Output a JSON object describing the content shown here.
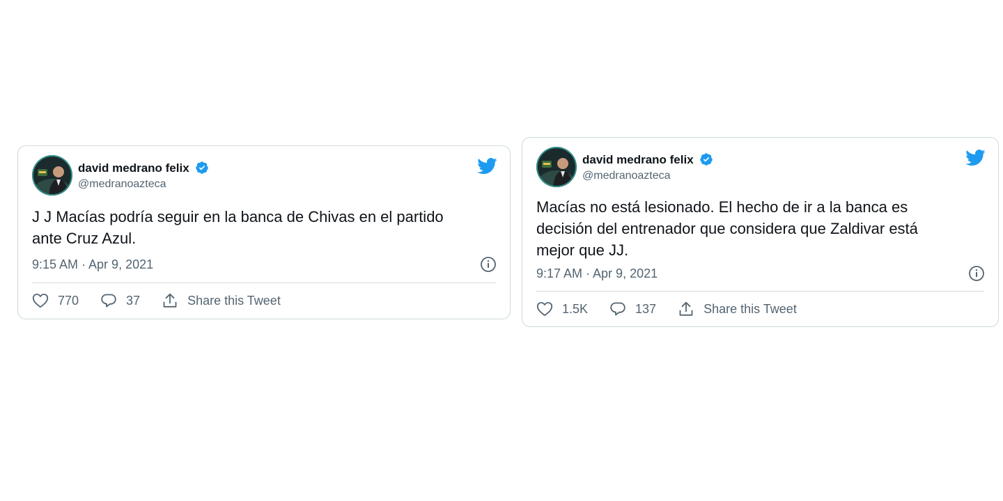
{
  "tweets": [
    {
      "author": {
        "name": "david medrano felix",
        "handle": "@medranoazteca"
      },
      "text": "J J Macías podría seguir en la banca de Chivas en el partido\nante Cruz Azul.",
      "timestamp": "9:15 AM · Apr 9, 2021",
      "likes": "770",
      "replies": "37",
      "share_label": "Share this Tweet"
    },
    {
      "author": {
        "name": "david medrano felix",
        "handle": "@medranoazteca"
      },
      "text": "Macías no está lesionado. El hecho de ir a la banca es\ndecisión del entrenador que considera que Zaldivar está\nmejor que JJ.",
      "timestamp": "9:17 AM · Apr 9, 2021",
      "likes": "1.5K",
      "replies": "137",
      "share_label": "Share this Tweet"
    }
  ],
  "icons": {
    "brand": "twitter-bird-icon",
    "verified": "verified-badge-icon",
    "info": "info-icon",
    "like": "heart-icon",
    "reply": "reply-icon",
    "share": "share-icon"
  },
  "colors": {
    "brand_blue": "#1d9bf0",
    "text_primary": "#0f1419",
    "text_secondary": "#536471",
    "border": "#cfd9de",
    "background": "#ffffff"
  }
}
